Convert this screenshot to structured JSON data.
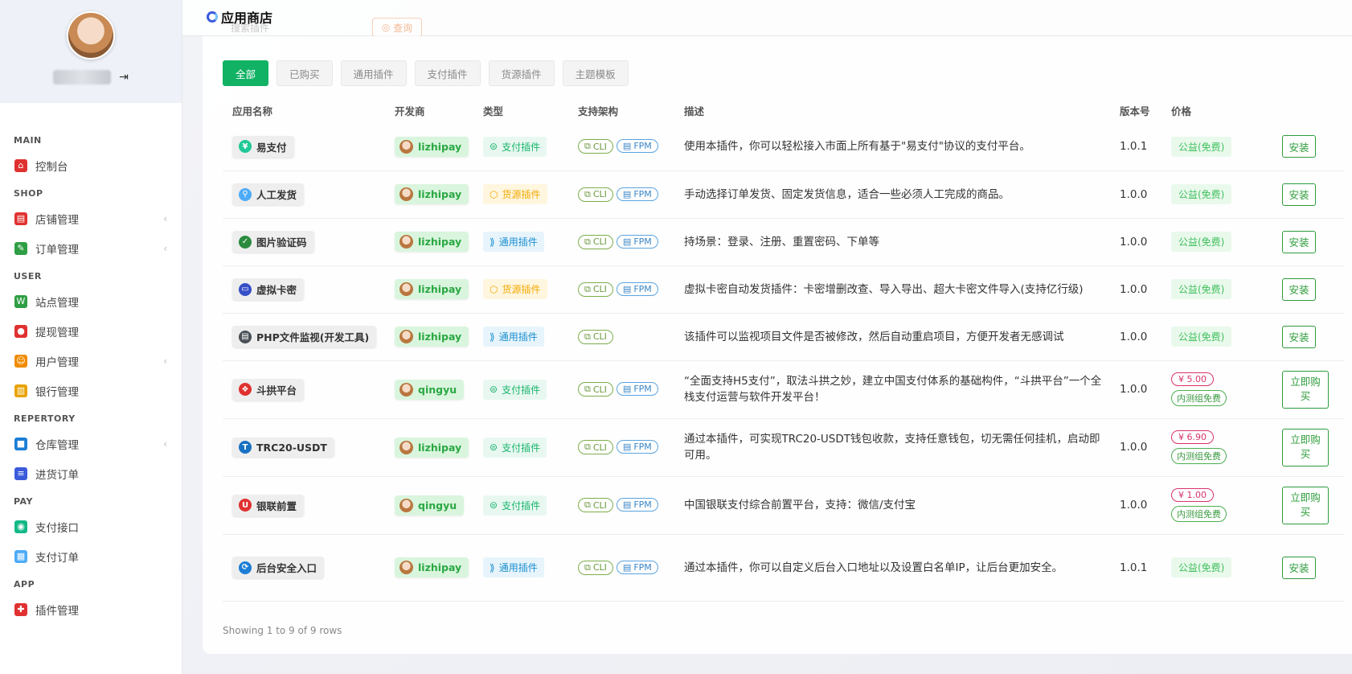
{
  "sidebar": {
    "sections": [
      {
        "title": "MAIN",
        "items": [
          {
            "label": "控制台",
            "icon": "home-icon",
            "color": "#e03131",
            "arrow": false
          }
        ]
      },
      {
        "title": "SHOP",
        "items": [
          {
            "label": "店铺管理",
            "icon": "store-icon",
            "color": "#e03131",
            "arrow": true
          },
          {
            "label": "订单管理",
            "icon": "order-edit-icon",
            "color": "#2f9e44",
            "arrow": true
          }
        ]
      },
      {
        "title": "USER",
        "items": [
          {
            "label": "站点管理",
            "icon": "www-icon",
            "color": "#2f9e44",
            "arrow": false
          },
          {
            "label": "提现管理",
            "icon": "withdraw-icon",
            "color": "#e03131",
            "arrow": false
          },
          {
            "label": "用户管理",
            "icon": "user-icon",
            "color": "#f08c00",
            "arrow": true
          },
          {
            "label": "银行管理",
            "icon": "bank-icon",
            "color": "#e8a200",
            "arrow": false
          }
        ]
      },
      {
        "title": "REPERTORY",
        "items": [
          {
            "label": "仓库管理",
            "icon": "warehouse-icon",
            "color": "#1c7ed6",
            "arrow": true
          },
          {
            "label": "进货订单",
            "icon": "purchase-icon",
            "color": "#3b5bdb",
            "arrow": false
          }
        ]
      },
      {
        "title": "PAY",
        "items": [
          {
            "label": "支付接口",
            "icon": "pay-api-icon",
            "color": "#12b886",
            "arrow": false
          },
          {
            "label": "支付订单",
            "icon": "pay-order-icon",
            "color": "#4dabf7",
            "arrow": false
          }
        ]
      },
      {
        "title": "APP",
        "items": [
          {
            "label": "插件管理",
            "icon": "puzzle-icon",
            "color": "#e03131",
            "arrow": false
          }
        ]
      }
    ]
  },
  "header": {
    "title": "应用商店",
    "search_placeholder": "搜索插件",
    "search_button": "查询"
  },
  "filters": [
    {
      "label": "全部",
      "active": true
    },
    {
      "label": "已购买",
      "active": false
    },
    {
      "label": "通用插件",
      "active": false
    },
    {
      "label": "支付插件",
      "active": false
    },
    {
      "label": "货源插件",
      "active": false
    },
    {
      "label": "主题模板",
      "active": false
    }
  ],
  "table": {
    "columns": [
      "应用名称",
      "开发商",
      "类型",
      "支持架构",
      "描述",
      "版本号",
      "价格",
      ""
    ],
    "rows": [
      {
        "name": "易支付",
        "icon": "epay-icon",
        "icon_color": "#20c997",
        "developer": "lizhipay",
        "type": "支付插件",
        "type_kind": "pay",
        "arch": [
          "CLI",
          "FPM"
        ],
        "description": "使用本插件，你可以轻松接入市面上所有基于\"易支付\"协议的支付平台。",
        "version": "1.0.1",
        "price": "公益(免费)",
        "paid": false,
        "action": "安装"
      },
      {
        "name": "人工发货",
        "icon": "manual-ship-icon",
        "icon_color": "#4dabf7",
        "developer": "lizhipay",
        "type": "货源插件",
        "type_kind": "goods",
        "arch": [
          "CLI",
          "FPM"
        ],
        "description": "手动选择订单发货、固定发货信息，适合一些必须人工完成的商品。",
        "version": "1.0.0",
        "price": "公益(免费)",
        "paid": false,
        "action": "安装"
      },
      {
        "name": "图片验证码",
        "icon": "shield-check-icon",
        "icon_color": "#2b8a3e",
        "developer": "lizhipay",
        "type": "通用插件",
        "type_kind": "common",
        "arch": [
          "CLI",
          "FPM"
        ],
        "description": "持场景：登录、注册、重置密码、下单等",
        "version": "1.0.0",
        "price": "公益(免费)",
        "paid": false,
        "action": "安装"
      },
      {
        "name": "虚拟卡密",
        "icon": "card-icon",
        "icon_color": "#364fc7",
        "developer": "lizhipay",
        "type": "货源插件",
        "type_kind": "goods",
        "arch": [
          "CLI",
          "FPM"
        ],
        "description": "虚拟卡密自动发货插件：卡密增删改查、导入导出、超大卡密文件导入(支持亿行级)",
        "version": "1.0.0",
        "price": "公益(免费)",
        "paid": false,
        "action": "安装"
      },
      {
        "name": "PHP文件监视(开发工具)",
        "icon": "file-watch-icon",
        "icon_color": "#495057",
        "developer": "lizhipay",
        "type": "通用插件",
        "type_kind": "common",
        "arch": [
          "CLI"
        ],
        "description": "该插件可以监视项目文件是否被修改，然后自动重启项目，方便开发者无感调试",
        "version": "1.0.0",
        "price": "公益(免费)",
        "paid": false,
        "action": "安装"
      },
      {
        "name": "斗拱平台",
        "icon": "dougong-icon",
        "icon_color": "#e03131",
        "developer": "qingyu",
        "type": "支付插件",
        "type_kind": "pay",
        "arch": [
          "CLI",
          "FPM"
        ],
        "description": "“全面支持H5支付”，取法斗拱之妙，建立中国支付体系的基础构件，“斗拱平台”一个全栈支付运营与软件开发平台！",
        "version": "1.0.0",
        "price": "¥ 5.00",
        "beta": "内测组免费",
        "paid": true,
        "action": "立即购买"
      },
      {
        "name": "TRC20-USDT",
        "icon": "tether-icon",
        "icon_color": "#1971c2",
        "developer": "lizhipay",
        "type": "支付插件",
        "type_kind": "pay",
        "arch": [
          "CLI",
          "FPM"
        ],
        "description": "通过本插件，可实现TRC20-USDT钱包收款，支持任意钱包，切无需任何挂机，启动即可用。",
        "version": "1.0.0",
        "price": "¥ 6.90",
        "beta": "内测组免费",
        "paid": true,
        "action": "立即购买"
      },
      {
        "name": "银联前置",
        "icon": "unionpay-icon",
        "icon_color": "#e03131",
        "developer": "qingyu",
        "type": "支付插件",
        "type_kind": "pay",
        "arch": [
          "CLI",
          "FPM"
        ],
        "description": "中国银联支付综合前置平台，支持：微信/支付宝",
        "version": "1.0.0",
        "price": "¥ 1.00",
        "beta": "内测组免费",
        "paid": true,
        "action": "立即购买"
      },
      {
        "name": "后台安全入口",
        "icon": "secure-entry-icon",
        "icon_color": "#1c7ed6",
        "developer": "lizhipay",
        "type": "通用插件",
        "type_kind": "common",
        "arch": [
          "CLI",
          "FPM"
        ],
        "description": "通过本插件，你可以自定义后台入口地址以及设置白名单IP，让后台更加安全。",
        "version": "1.0.1",
        "price": "公益(免费)",
        "paid": false,
        "action": "安装"
      }
    ]
  },
  "footer": "Showing 1 to 9 of 9 rows"
}
